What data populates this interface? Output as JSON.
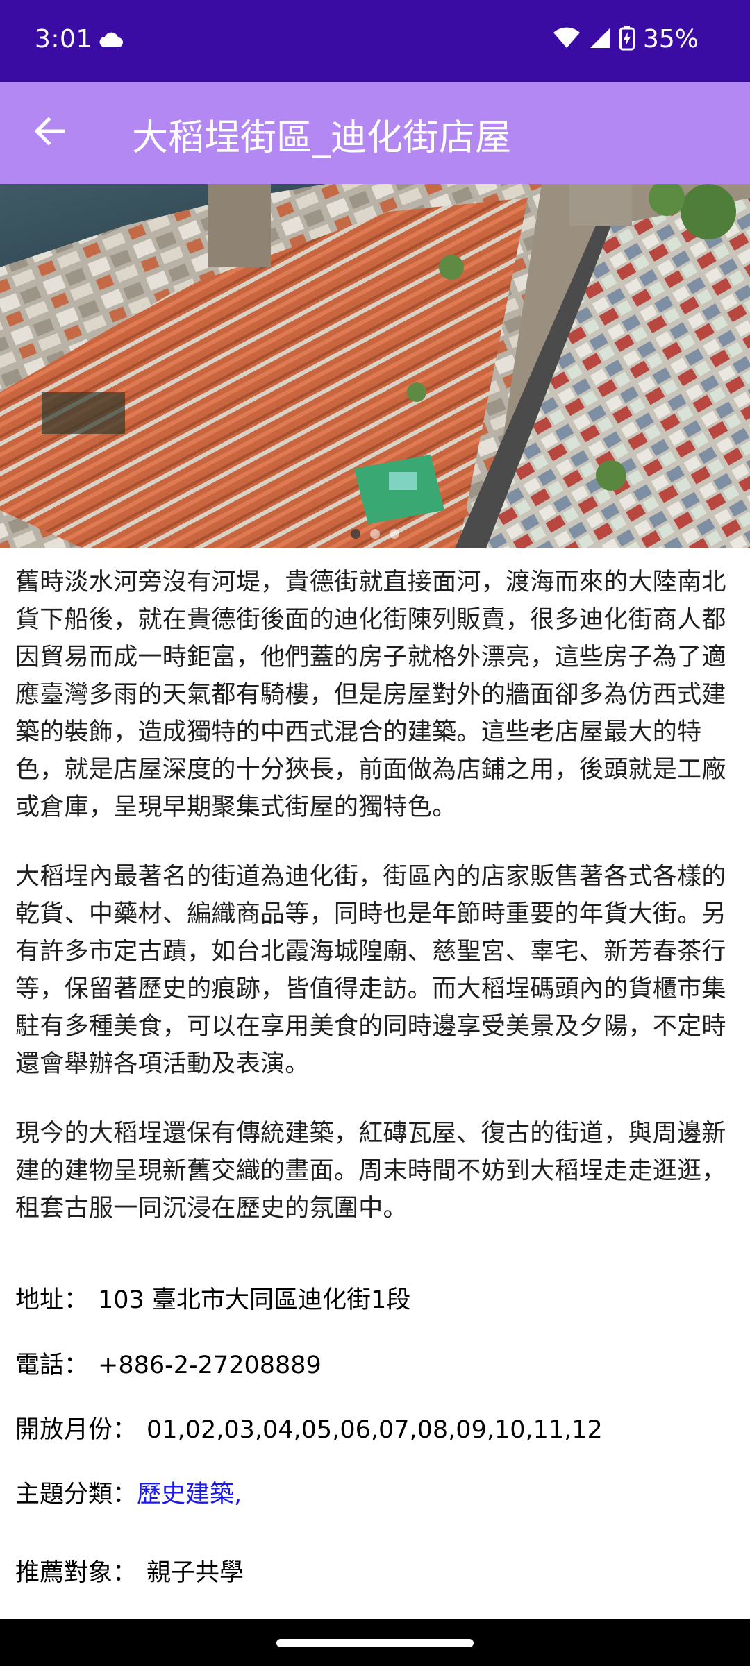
{
  "status_bar": {
    "time": "3:01",
    "battery": "35%",
    "icons": [
      "cloud-icon",
      "wifi-icon",
      "signal-icon",
      "battery-charging-icon"
    ]
  },
  "app_bar": {
    "title": "大稻埕街區_迪化街店屋",
    "back_icon": "arrow-left-icon",
    "color": "#b388f2"
  },
  "hero": {
    "carousel_page": 1,
    "carousel_total": 3
  },
  "description": {
    "paragraphs": [
      "舊時淡水河旁沒有河堤，貴德街就直接面河，渡海而來的大陸南北貨下船後，就在貴德街後面的迪化街陳列販賣，很多迪化街商人都因貿易而成一時鉅富，他們蓋的房子就格外漂亮，這些房子為了適應臺灣多雨的天氣都有騎樓，但是房屋對外的牆面卻多為仿西式建築的裝飾，造成獨特的中西式混合的建築。這些老店屋最大的特色，就是店屋深度的十分狹長，前面做為店鋪之用，後頭就是工廠或倉庫，呈現早期聚集式街屋的獨特色。",
      "大稻埕內最著名的街道為迪化街，街區內的店家販售著各式各樣的乾貨、中藥材、編織商品等，同時也是年節時重要的年貨大街。另有許多市定古蹟，如台北霞海城隍廟、慈聖宮、辜宅、新芳春茶行等，保留著歷史的痕跡，皆值得走訪。而大稻埕碼頭內的貨櫃市集駐有多種美食，可以在享用美食的同時邊享受美景及夕陽，不定時還會舉辦各項活動及表演。",
      "現今的大稻埕還保有傳統建築，紅磚瓦屋、復古的街道，與周邊新建的建物呈現新舊交織的畫面。周末時間不妨到大稻埕走走逛逛，租套古服一同沉浸在歷史的氛圍中。"
    ]
  },
  "info": {
    "address_label": "地址：",
    "address_value": "103 臺北市大同區迪化街1段",
    "phone_label": "電話：",
    "phone_value": "+886-2-27208889",
    "months_label": "開放月份：",
    "months_value": "01,02,03,04,05,06,07,08,09,10,11,12",
    "category_label": "主題分類：",
    "category_value": "歷史建築,",
    "audience_label": "推薦對象：",
    "audience_value": "親子共學"
  },
  "colors": {
    "status_bar": "#3a0ca3",
    "app_bar": "#b388f2",
    "link": "#1a1ae6"
  }
}
